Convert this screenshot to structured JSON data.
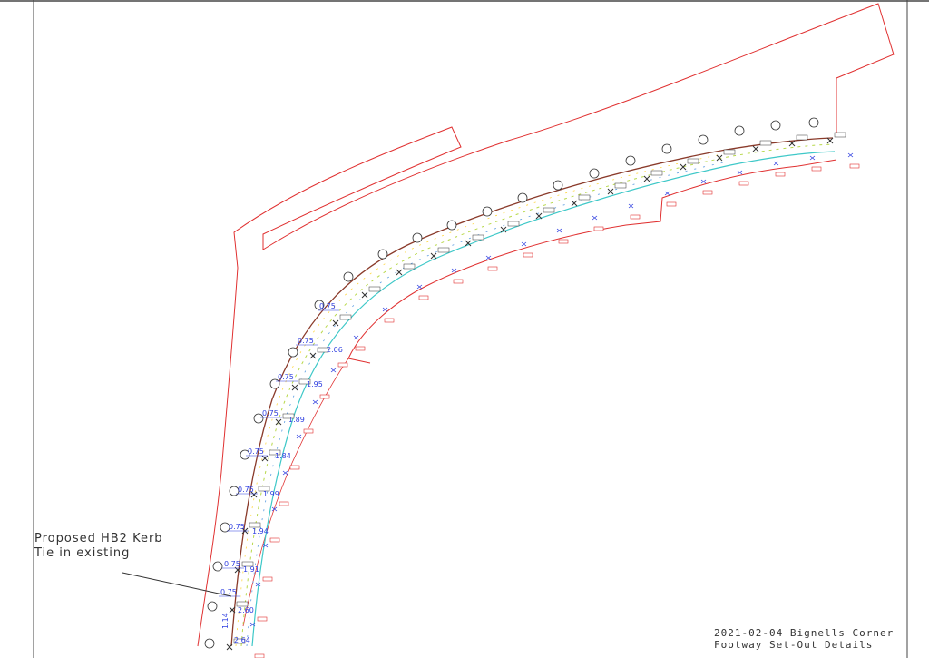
{
  "annotation": {
    "line1": "Proposed HB2 Kerb",
    "line2": "Tie in existing"
  },
  "title_block": {
    "line1": "2021-02-04 Bignells Corner",
    "line2": "Footway Set-Out  Details"
  },
  "widths": {
    "verge": [
      "0.75",
      "0.75",
      "0.75",
      "0.75",
      "0.75",
      "0.75",
      "0.75",
      "0.75",
      "0.75"
    ],
    "footway": [
      "2.64",
      "2.60",
      "1.91",
      "1.94",
      "1.99",
      "1.84",
      "1.89",
      "1.95",
      "2.06"
    ],
    "side": "1.14"
  },
  "colors": {
    "boundary": "#e03030",
    "kerb_back": "#8a3a2a",
    "kerb_front": "#3ec8c8",
    "footway_hatch": "#b8d84a",
    "dimension": "#2f3fe0",
    "label": "#222222",
    "chainage_box": "#e03030"
  }
}
